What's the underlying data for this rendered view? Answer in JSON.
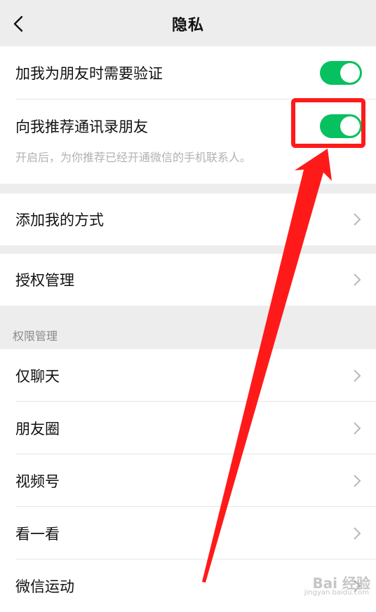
{
  "header": {
    "title": "隐私"
  },
  "friend_settings": {
    "verify_label": "加我为朋友时需要验证",
    "verify_on": true,
    "recommend_label": "向我推荐通讯录朋友",
    "recommend_on": true,
    "recommend_hint": "开启后，为你推荐已经开通微信的手机联系人。"
  },
  "add_methods": {
    "label": "添加我的方式"
  },
  "authorization": {
    "label": "授权管理"
  },
  "permissions": {
    "section_title": "权限管理",
    "items": [
      {
        "label": "仅聊天"
      },
      {
        "label": "朋友圈"
      },
      {
        "label": "视频号"
      },
      {
        "label": "看一看"
      },
      {
        "label": "微信运动"
      }
    ]
  },
  "annotation": {
    "highlight_color": "#ff1a1a"
  },
  "watermark": {
    "text": "Bai 经验",
    "sub": "jingyan.baidu.com"
  },
  "colors": {
    "toggle_on": "#07c160",
    "background": "#ededed"
  }
}
